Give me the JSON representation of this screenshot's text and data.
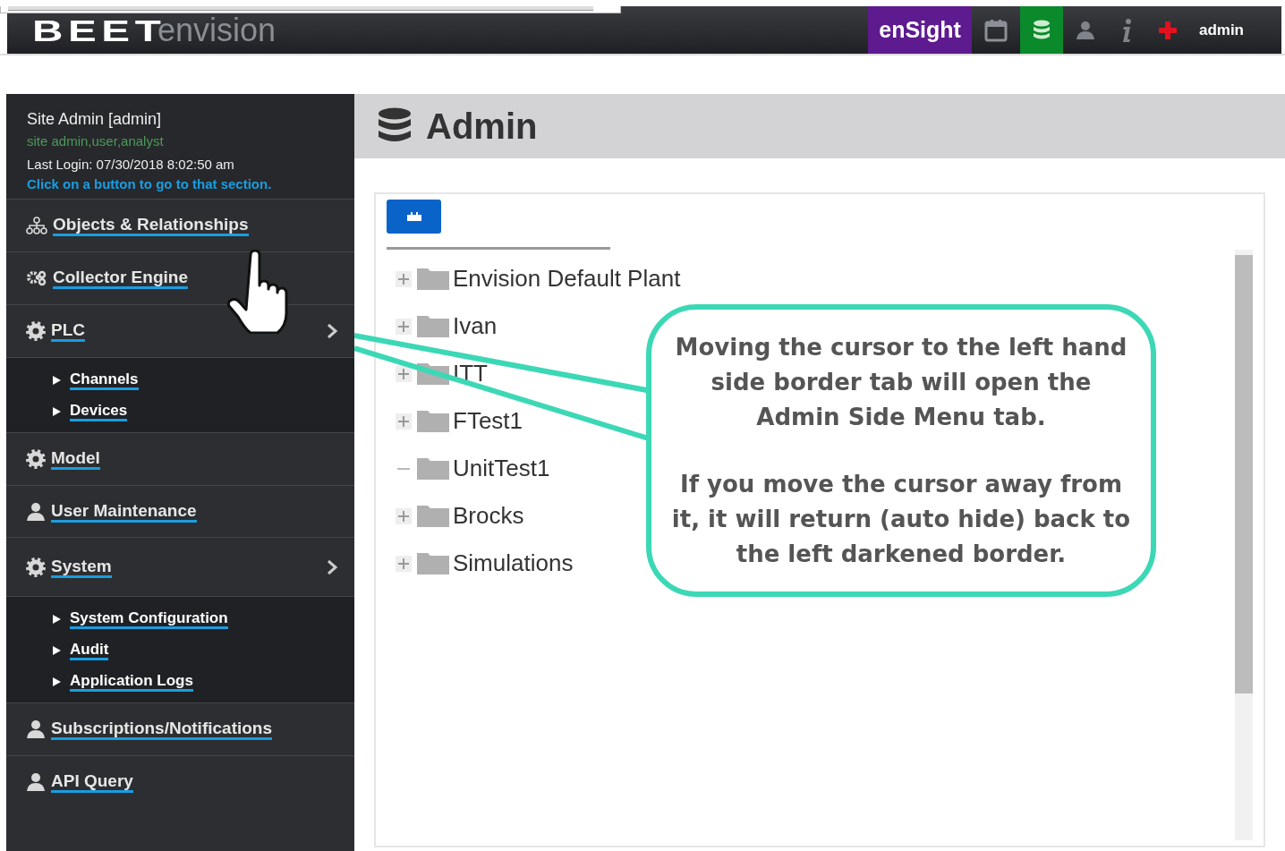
{
  "topbar": {
    "logo": "BEET",
    "product": "envision",
    "nav": [
      {
        "kind": "brand",
        "label": "enSight",
        "selected": false
      },
      {
        "kind": "calendar",
        "selected": false
      },
      {
        "kind": "database",
        "selected": true
      },
      {
        "kind": "user",
        "selected": false
      },
      {
        "kind": "info",
        "selected": false
      },
      {
        "kind": "plus",
        "selected": false
      },
      {
        "kind": "text",
        "label": "admin",
        "selected": false
      }
    ]
  },
  "sidebar": {
    "user": "Site Admin [admin]",
    "roles": "site admin,user,analyst",
    "last_login": "Last Login: 07/30/2018 8:02:50 am",
    "hint": "Click on a button to go to that section.",
    "items": [
      {
        "label": "Objects & Relationships"
      },
      {
        "label": "Collector Engine"
      },
      {
        "label": "PLC",
        "children": [
          {
            "label": "Channels"
          },
          {
            "label": "Devices"
          }
        ]
      },
      {
        "label": "Model"
      },
      {
        "label": "User Maintenance"
      },
      {
        "label": "System",
        "children": [
          {
            "label": "System Configuration"
          },
          {
            "label": "Audit"
          },
          {
            "label": "Application Logs"
          }
        ]
      },
      {
        "label": "Subscriptions/Notifications"
      },
      {
        "label": "API Query"
      }
    ]
  },
  "page": {
    "title": "Admin"
  },
  "tree": {
    "nodes": [
      {
        "label": "Envision Default Plant",
        "expandable": true
      },
      {
        "label": "Ivan",
        "expandable": true
      },
      {
        "label": "ITT",
        "expandable": true
      },
      {
        "label": "FTest1",
        "expandable": true
      },
      {
        "label": "UnitTest1",
        "expandable": false
      },
      {
        "label": "Brocks",
        "expandable": true
      },
      {
        "label": "Simulations",
        "expandable": true
      }
    ]
  },
  "callout": {
    "paragraphs": [
      "Moving the cursor to the left hand side border tab will open the Admin Side Menu tab.",
      "If you move the cursor away from it, it will return (auto hide) back to the left darkened border."
    ]
  }
}
